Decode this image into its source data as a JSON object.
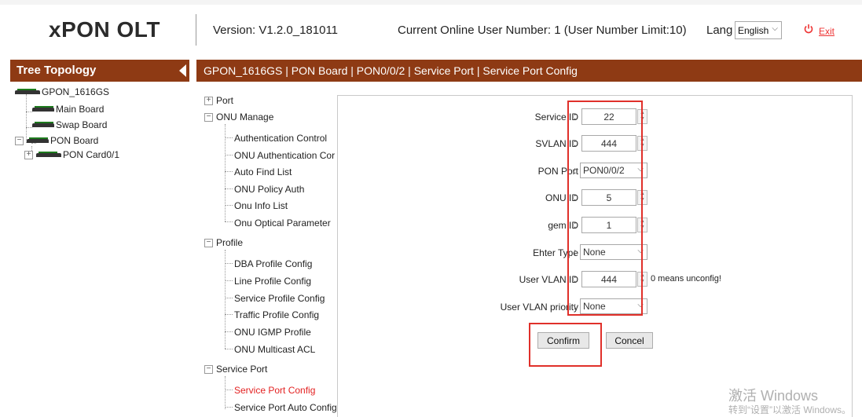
{
  "header": {
    "brand": "xPON OLT",
    "version": "Version: V1.2.0_181011",
    "online": "Current Online User Number: 1 (User Number Limit:10)",
    "lang_label": "Lang",
    "lang_value": "English",
    "exit_label": "Exit"
  },
  "tree": {
    "title": "Tree Topology",
    "root": "GPON_1616GS",
    "main_board": "Main Board",
    "swap_board": "Swap Board",
    "pon_board": "PON Board",
    "pon_card": "PON Card0/1"
  },
  "breadcrumb": "GPON_1616GS | PON Board | PON0/0/2 | Service Port | Service Port Config",
  "menu": {
    "port": "Port",
    "onu_manage": "ONU Manage",
    "onu_items": [
      "Authentication Control",
      "ONU Authentication Cor",
      "Auto Find List",
      "ONU Policy Auth",
      "Onu Info List",
      "Onu Optical Parameter"
    ],
    "profile": "Profile",
    "profile_items": [
      "DBA Profile Config",
      "Line Profile Config",
      "Service Profile Config",
      "Traffic Profile Config",
      "ONU IGMP Profile",
      "ONU Multicast ACL"
    ],
    "service_port": "Service Port",
    "service_items": [
      "Service Port Config",
      "Service Port Auto Config"
    ]
  },
  "form": {
    "service_id": {
      "label": "Service ID",
      "value": "22"
    },
    "svlan_id": {
      "label": "SVLAN ID",
      "value": "444"
    },
    "pon_port": {
      "label": "PON Port",
      "value": "PON0/0/2"
    },
    "onu_id": {
      "label": "ONU ID",
      "value": "5"
    },
    "gem_id": {
      "label": "gem ID",
      "value": "1"
    },
    "ether_type": {
      "label": "Ehter Type",
      "value": "None"
    },
    "user_vlan_id": {
      "label": "User VLAN ID",
      "value": "444",
      "hint": "0 means unconfig!"
    },
    "user_vlan_priority": {
      "label": "User VLAN priority",
      "value": "None"
    },
    "confirm_label": "Confirm",
    "cancel_label": "Concel"
  },
  "watermark": {
    "line1": "激活 Windows",
    "line2": "转到“设置”以激活 Windows。"
  },
  "colors": {
    "accent": "#8e3a14",
    "highlight": "#e0302a",
    "active_menu": "#e32222"
  }
}
